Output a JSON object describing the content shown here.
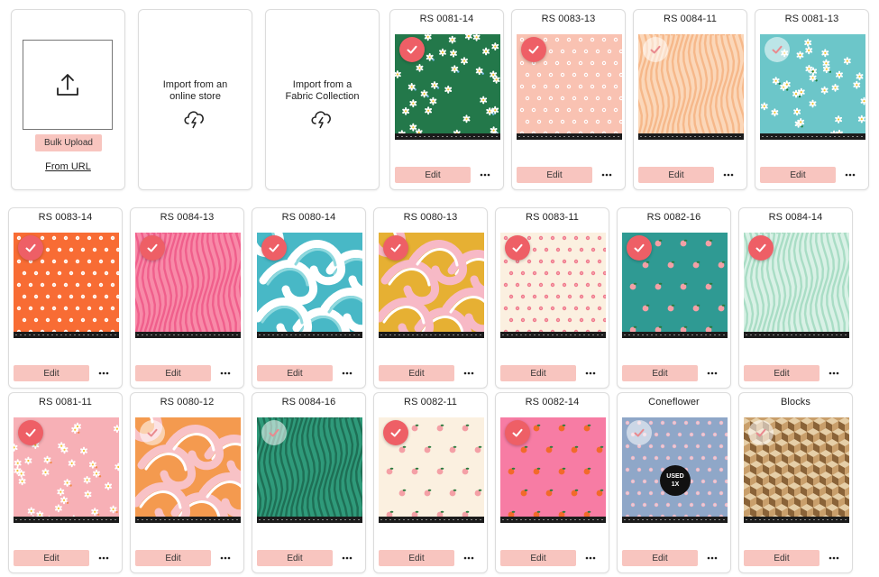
{
  "actions": {
    "bulk_upload_label": "Bulk Upload",
    "from_url_label": "From URL",
    "import_store_label": "Import from an\nonline store",
    "import_collection_label": "Import from a\nFabric Collection"
  },
  "common": {
    "edit_label": "Edit",
    "more_icon": "more-horizontal-icon",
    "check_icon": "check-circle-icon"
  },
  "colors": {
    "accent": "#ee5f66",
    "button_bg": "#f8c5bf"
  },
  "fabrics": [
    {
      "title": "RS 0081-14",
      "selected": true,
      "pattern": "daisies",
      "bg": "#23784a",
      "fg": "#ffffff",
      "fg2": "#7cc1f0"
    },
    {
      "title": "RS 0083-13",
      "selected": true,
      "pattern": "dots",
      "bg": "#f9c2b2",
      "fg": "#ffffff",
      "fg2": "#f1a090"
    },
    {
      "title": "RS 0084-11",
      "selected": false,
      "pattern": "waves",
      "bg": "#fbd7b9",
      "fg": "#f6b88a",
      "fg2": "#f6b88a"
    },
    {
      "title": "RS 0081-13",
      "selected": false,
      "pattern": "daisies",
      "bg": "#6cc6c9",
      "fg": "#ffffff",
      "fg2": "#1f7f3e"
    },
    {
      "title": "RS 0083-14",
      "selected": true,
      "pattern": "dots",
      "bg": "#f86c34",
      "fg": "#ffffff",
      "fg2": "#ffd5b9"
    },
    {
      "title": "RS 0084-13",
      "selected": true,
      "pattern": "waves",
      "bg": "#f88aa8",
      "fg": "#f05f8c",
      "fg2": "#f05f8c"
    },
    {
      "title": "RS 0080-14",
      "selected": true,
      "pattern": "swirl",
      "bg": "#48b8c6",
      "fg": "#ffffff",
      "fg2": "#8fd9de"
    },
    {
      "title": "RS 0080-13",
      "selected": true,
      "pattern": "swirl",
      "bg": "#e6b033",
      "fg": "#f7b9c6",
      "fg2": "#ffffff"
    },
    {
      "title": "RS 0083-11",
      "selected": true,
      "pattern": "dots",
      "bg": "#fbf0e0",
      "fg": "#f07a8c",
      "fg2": "#f7b4bd"
    },
    {
      "title": "RS 0082-16",
      "selected": true,
      "pattern": "fruit",
      "bg": "#2f9a93",
      "fg": "#f4a0a6",
      "fg2": "#2a7a3e"
    },
    {
      "title": "RS 0084-14",
      "selected": true,
      "pattern": "waves",
      "bg": "#d9f1e6",
      "fg": "#a9ddc5",
      "fg2": "#a9ddc5"
    },
    {
      "title": "RS 0081-11",
      "selected": true,
      "pattern": "daisies",
      "bg": "#f7b0b6",
      "fg": "#ffffff",
      "fg2": "#f28a4a"
    },
    {
      "title": "RS 0080-12",
      "selected": false,
      "pattern": "swirl",
      "bg": "#f49a4f",
      "fg": "#f8c2c6",
      "fg2": "#ffffff"
    },
    {
      "title": "RS 0084-16",
      "selected": false,
      "pattern": "waves",
      "bg": "#2f9a7a",
      "fg": "#1e6f55",
      "fg2": "#1e6f55"
    },
    {
      "title": "RS 0082-11",
      "selected": true,
      "pattern": "fruit",
      "bg": "#fbf0e0",
      "fg": "#f4a0a6",
      "fg2": "#2a7a3e"
    },
    {
      "title": "RS 0082-14",
      "selected": true,
      "pattern": "fruit",
      "bg": "#f77ca4",
      "fg": "#f26a2a",
      "fg2": "#2a7a3e"
    },
    {
      "title": "Coneflower",
      "selected": false,
      "pattern": "dots",
      "bg": "#8fa7c8",
      "fg": "#f3b9c6",
      "fg2": "#d4dcea",
      "badge": "USED\n1X"
    },
    {
      "title": "Blocks",
      "selected": false,
      "pattern": "blocks",
      "bg": "#c99f6b",
      "fg": "#8a6338",
      "fg2": "#e6cfa8"
    }
  ]
}
